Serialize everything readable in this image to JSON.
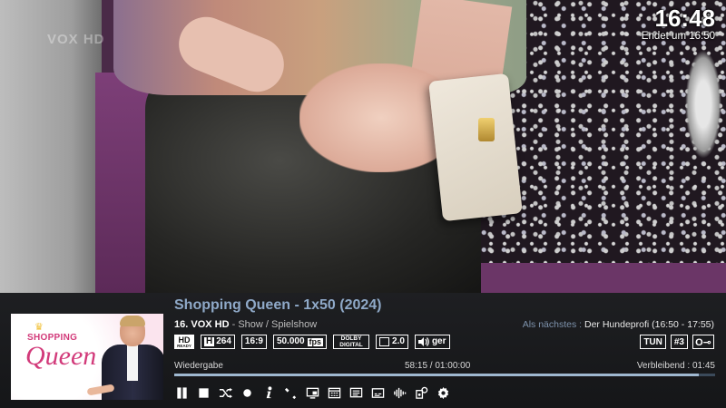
{
  "video": {
    "watermark": "VOX HD"
  },
  "clock": {
    "time": "16:48",
    "end_text": "Endet um 16:50"
  },
  "poster": {
    "shop": "SHOPPING",
    "queen": "Queen"
  },
  "event": {
    "title": "Shopping Queen - 1x50 (2024)",
    "channel_number": "16.",
    "channel_name": "VOX HD",
    "genre": "- Show / Spielshow"
  },
  "next": {
    "label": "Als nächstes :",
    "value": "Der Hundeprofi (16:50 - 17:55)"
  },
  "badges": {
    "hd_top": "HD",
    "hd_bottom": "READY",
    "h_letter": "H",
    "codec": "264",
    "aspect": "16:9",
    "fps_value": "50.000",
    "fps_unit": "fps",
    "dolby_top": "DOLBY",
    "dolby_bottom": "DIGITAL",
    "channels": "2.0",
    "audio_lang": "ger"
  },
  "right_badges": {
    "tuner": "TUN",
    "tuner_number": "#3",
    "key": "O⊸"
  },
  "playback": {
    "label": "Wiedergabe",
    "position": "58:15 / 01:00:00",
    "remaining": "Verbleibend : 01:45",
    "progress": 0.97
  },
  "controls": [
    {
      "name": "pause-icon"
    },
    {
      "name": "stop-icon"
    },
    {
      "name": "shuffle-icon"
    },
    {
      "name": "record-icon"
    },
    {
      "name": "info-icon"
    },
    {
      "name": "tools-icon"
    },
    {
      "name": "pip-icon"
    },
    {
      "name": "epg-icon"
    },
    {
      "name": "teletext-icon"
    },
    {
      "name": "subtitle-icon"
    },
    {
      "name": "audio-icon"
    },
    {
      "name": "plugin-icon"
    },
    {
      "name": "settings-icon"
    }
  ],
  "colors": {
    "title": "#8fa9c8",
    "next_label": "#7e93ad",
    "progress_fill": "#9fb8d0",
    "progress_track": "#3b4a5a",
    "bar_bg": "#1a1b1e"
  }
}
